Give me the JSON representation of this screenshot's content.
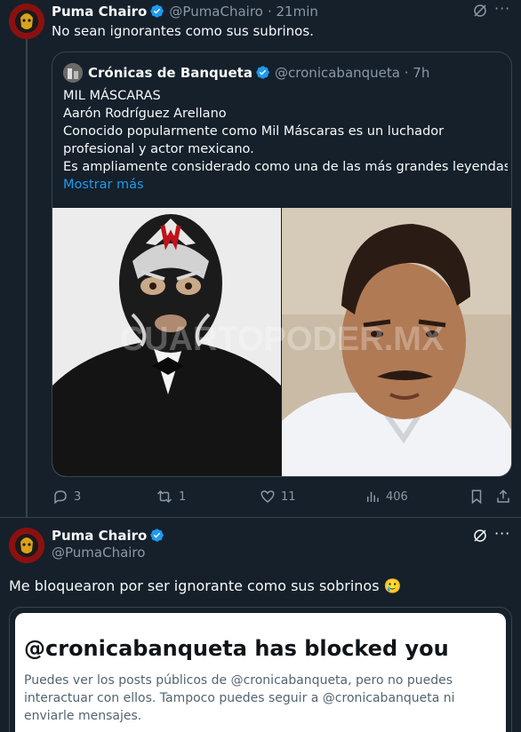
{
  "tweet1": {
    "name": "Puma Chairo",
    "handle": "@PumaChairo",
    "time": "· 21min",
    "text": "No sean ignorantes como sus subrinos.",
    "stats": {
      "replies": "3",
      "retweets": "1",
      "likes": "11",
      "views": "406"
    }
  },
  "quote": {
    "name": "Crónicas de Banqueta",
    "handle": "@cronicabanqueta · 7h",
    "lines": [
      "MIL MÁSCARAS",
      "Aarón Rodríguez Arellano",
      "Conocido popularmente como Mil Máscaras es un luchador",
      "profesional y actor mexicano.",
      "Es ampliamente considerado como una de las más grandes leyendas ..."
    ],
    "show_more": "Mostrar más",
    "watermark": "CUARTOPODER.MX"
  },
  "tweet2": {
    "name": "Puma Chairo",
    "handle": "@PumaChairo",
    "text": "Me bloquearon por ser ignorante como sus sobrinos 🥲"
  },
  "blocked_card": {
    "title": "@cronicabanqueta has blocked you",
    "body": "Puedes ver los posts públicos de @cronicabanqueta, pero no puedes interactuar con ellos. Tampoco puedes seguir a @cronicabanqueta ni enviarle mensajes."
  },
  "colors": {
    "background": "#15202b",
    "accent": "#1d9bf0",
    "muted": "#8b98a5",
    "border": "#38444d"
  }
}
